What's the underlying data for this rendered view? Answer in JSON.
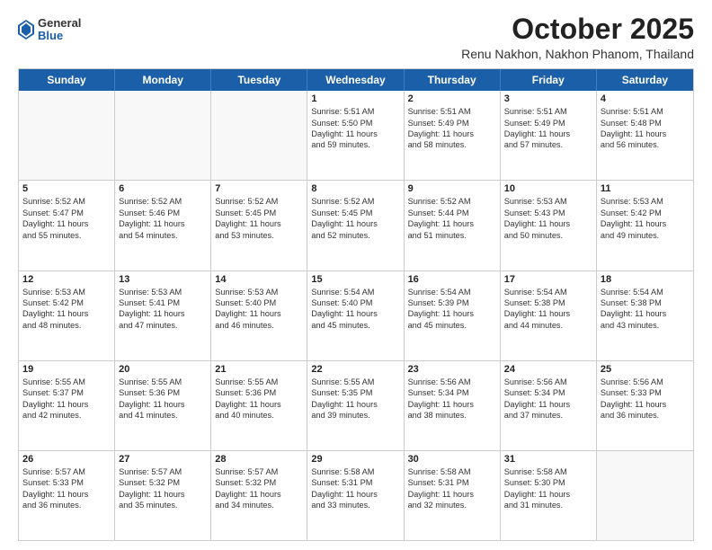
{
  "header": {
    "logo": {
      "general": "General",
      "blue": "Blue"
    },
    "title": "October 2025",
    "subtitle": "Renu Nakhon, Nakhon Phanom, Thailand"
  },
  "calendar": {
    "days_of_week": [
      "Sunday",
      "Monday",
      "Tuesday",
      "Wednesday",
      "Thursday",
      "Friday",
      "Saturday"
    ],
    "weeks": [
      [
        {
          "day": "",
          "empty": true
        },
        {
          "day": "",
          "empty": true
        },
        {
          "day": "",
          "empty": true
        },
        {
          "day": "1",
          "lines": [
            "Sunrise: 5:51 AM",
            "Sunset: 5:50 PM",
            "Daylight: 11 hours",
            "and 59 minutes."
          ]
        },
        {
          "day": "2",
          "lines": [
            "Sunrise: 5:51 AM",
            "Sunset: 5:49 PM",
            "Daylight: 11 hours",
            "and 58 minutes."
          ]
        },
        {
          "day": "3",
          "lines": [
            "Sunrise: 5:51 AM",
            "Sunset: 5:49 PM",
            "Daylight: 11 hours",
            "and 57 minutes."
          ]
        },
        {
          "day": "4",
          "lines": [
            "Sunrise: 5:51 AM",
            "Sunset: 5:48 PM",
            "Daylight: 11 hours",
            "and 56 minutes."
          ]
        }
      ],
      [
        {
          "day": "5",
          "lines": [
            "Sunrise: 5:52 AM",
            "Sunset: 5:47 PM",
            "Daylight: 11 hours",
            "and 55 minutes."
          ]
        },
        {
          "day": "6",
          "lines": [
            "Sunrise: 5:52 AM",
            "Sunset: 5:46 PM",
            "Daylight: 11 hours",
            "and 54 minutes."
          ]
        },
        {
          "day": "7",
          "lines": [
            "Sunrise: 5:52 AM",
            "Sunset: 5:45 PM",
            "Daylight: 11 hours",
            "and 53 minutes."
          ]
        },
        {
          "day": "8",
          "lines": [
            "Sunrise: 5:52 AM",
            "Sunset: 5:45 PM",
            "Daylight: 11 hours",
            "and 52 minutes."
          ]
        },
        {
          "day": "9",
          "lines": [
            "Sunrise: 5:52 AM",
            "Sunset: 5:44 PM",
            "Daylight: 11 hours",
            "and 51 minutes."
          ]
        },
        {
          "day": "10",
          "lines": [
            "Sunrise: 5:53 AM",
            "Sunset: 5:43 PM",
            "Daylight: 11 hours",
            "and 50 minutes."
          ]
        },
        {
          "day": "11",
          "lines": [
            "Sunrise: 5:53 AM",
            "Sunset: 5:42 PM",
            "Daylight: 11 hours",
            "and 49 minutes."
          ]
        }
      ],
      [
        {
          "day": "12",
          "lines": [
            "Sunrise: 5:53 AM",
            "Sunset: 5:42 PM",
            "Daylight: 11 hours",
            "and 48 minutes."
          ]
        },
        {
          "day": "13",
          "lines": [
            "Sunrise: 5:53 AM",
            "Sunset: 5:41 PM",
            "Daylight: 11 hours",
            "and 47 minutes."
          ]
        },
        {
          "day": "14",
          "lines": [
            "Sunrise: 5:53 AM",
            "Sunset: 5:40 PM",
            "Daylight: 11 hours",
            "and 46 minutes."
          ]
        },
        {
          "day": "15",
          "lines": [
            "Sunrise: 5:54 AM",
            "Sunset: 5:40 PM",
            "Daylight: 11 hours",
            "and 45 minutes."
          ]
        },
        {
          "day": "16",
          "lines": [
            "Sunrise: 5:54 AM",
            "Sunset: 5:39 PM",
            "Daylight: 11 hours",
            "and 45 minutes."
          ]
        },
        {
          "day": "17",
          "lines": [
            "Sunrise: 5:54 AM",
            "Sunset: 5:38 PM",
            "Daylight: 11 hours",
            "and 44 minutes."
          ]
        },
        {
          "day": "18",
          "lines": [
            "Sunrise: 5:54 AM",
            "Sunset: 5:38 PM",
            "Daylight: 11 hours",
            "and 43 minutes."
          ]
        }
      ],
      [
        {
          "day": "19",
          "lines": [
            "Sunrise: 5:55 AM",
            "Sunset: 5:37 PM",
            "Daylight: 11 hours",
            "and 42 minutes."
          ]
        },
        {
          "day": "20",
          "lines": [
            "Sunrise: 5:55 AM",
            "Sunset: 5:36 PM",
            "Daylight: 11 hours",
            "and 41 minutes."
          ]
        },
        {
          "day": "21",
          "lines": [
            "Sunrise: 5:55 AM",
            "Sunset: 5:36 PM",
            "Daylight: 11 hours",
            "and 40 minutes."
          ]
        },
        {
          "day": "22",
          "lines": [
            "Sunrise: 5:55 AM",
            "Sunset: 5:35 PM",
            "Daylight: 11 hours",
            "and 39 minutes."
          ]
        },
        {
          "day": "23",
          "lines": [
            "Sunrise: 5:56 AM",
            "Sunset: 5:34 PM",
            "Daylight: 11 hours",
            "and 38 minutes."
          ]
        },
        {
          "day": "24",
          "lines": [
            "Sunrise: 5:56 AM",
            "Sunset: 5:34 PM",
            "Daylight: 11 hours",
            "and 37 minutes."
          ]
        },
        {
          "day": "25",
          "lines": [
            "Sunrise: 5:56 AM",
            "Sunset: 5:33 PM",
            "Daylight: 11 hours",
            "and 36 minutes."
          ]
        }
      ],
      [
        {
          "day": "26",
          "lines": [
            "Sunrise: 5:57 AM",
            "Sunset: 5:33 PM",
            "Daylight: 11 hours",
            "and 36 minutes."
          ]
        },
        {
          "day": "27",
          "lines": [
            "Sunrise: 5:57 AM",
            "Sunset: 5:32 PM",
            "Daylight: 11 hours",
            "and 35 minutes."
          ]
        },
        {
          "day": "28",
          "lines": [
            "Sunrise: 5:57 AM",
            "Sunset: 5:32 PM",
            "Daylight: 11 hours",
            "and 34 minutes."
          ]
        },
        {
          "day": "29",
          "lines": [
            "Sunrise: 5:58 AM",
            "Sunset: 5:31 PM",
            "Daylight: 11 hours",
            "and 33 minutes."
          ]
        },
        {
          "day": "30",
          "lines": [
            "Sunrise: 5:58 AM",
            "Sunset: 5:31 PM",
            "Daylight: 11 hours",
            "and 32 minutes."
          ]
        },
        {
          "day": "31",
          "lines": [
            "Sunrise: 5:58 AM",
            "Sunset: 5:30 PM",
            "Daylight: 11 hours",
            "and 31 minutes."
          ]
        },
        {
          "day": "",
          "empty": true
        }
      ]
    ]
  }
}
